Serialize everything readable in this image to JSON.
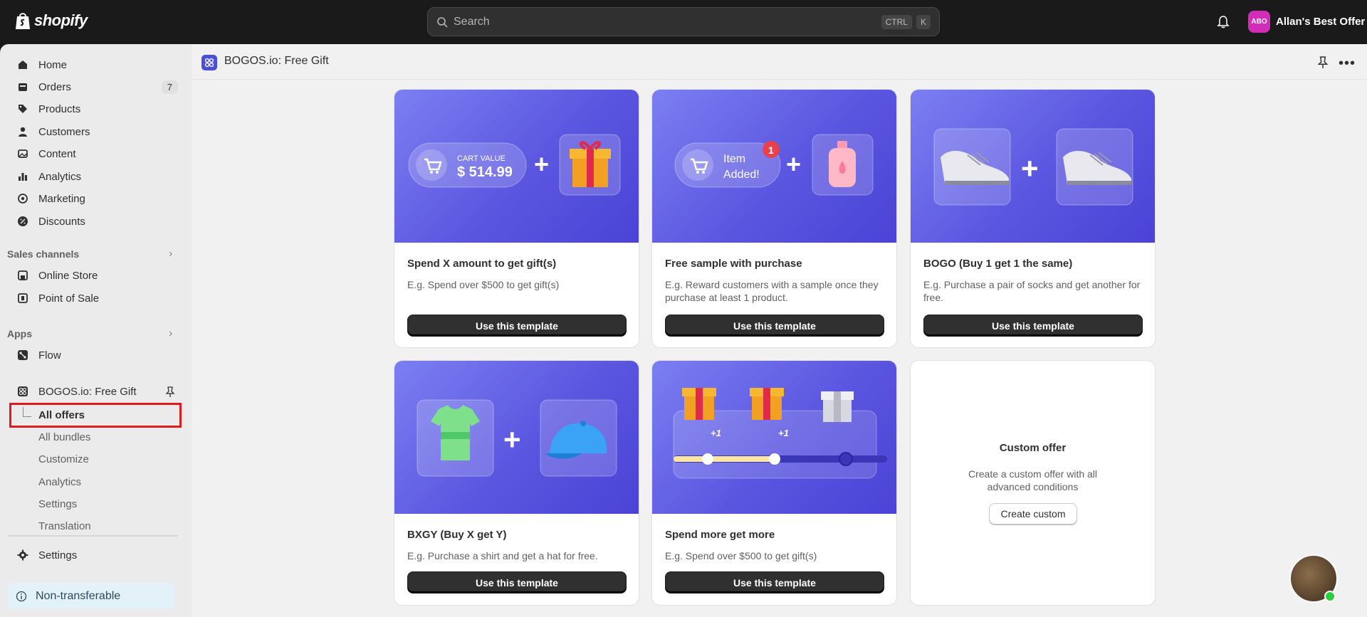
{
  "topbar": {
    "logo_text": "shopify",
    "search_placeholder": "Search",
    "shortcut_ctrl": "CTRL",
    "shortcut_k": "K",
    "store_initials": "ABO",
    "store_name": "Allan's Best Offer"
  },
  "sidebar": {
    "items": [
      {
        "label": "Home",
        "icon": "home-icon"
      },
      {
        "label": "Orders",
        "icon": "orders-icon",
        "badge": "7"
      },
      {
        "label": "Products",
        "icon": "tag-icon"
      },
      {
        "label": "Customers",
        "icon": "person-icon"
      },
      {
        "label": "Content",
        "icon": "content-icon"
      },
      {
        "label": "Analytics",
        "icon": "bar-chart-icon"
      },
      {
        "label": "Marketing",
        "icon": "target-icon"
      },
      {
        "label": "Discounts",
        "icon": "discount-icon"
      }
    ],
    "sales_channels_title": "Sales channels",
    "sales_channels": [
      {
        "label": "Online Store",
        "icon": "store-icon"
      },
      {
        "label": "Point of Sale",
        "icon": "pos-icon"
      }
    ],
    "apps_title": "Apps",
    "apps": [
      {
        "label": "Flow",
        "icon": "flow-icon"
      },
      {
        "label": "BOGOS.io: Free Gift",
        "icon": "bogos-app-icon"
      }
    ],
    "app_sub_items": [
      "All offers",
      "All bundles",
      "Customize",
      "Analytics",
      "Settings",
      "Translation"
    ],
    "settings_label": "Settings",
    "non_transferable": "Non-transferable"
  },
  "app_header": {
    "title": "BOGOS.io: Free Gift"
  },
  "cards": [
    {
      "title": "Spend X amount to get gift(s)",
      "desc": "E.g. Spend over $500 to get gift(s)",
      "button": "Use this template",
      "img_label_1": "CART VALUE",
      "img_label_2": "$ 514.99"
    },
    {
      "title": "Free sample with purchase",
      "desc": "E.g. Reward customers with a sample once they purchase at least 1 product.",
      "button": "Use this template",
      "img_label_1": "Item",
      "img_label_2": "Added!",
      "img_badge": "1"
    },
    {
      "title": "BOGO (Buy 1 get 1 the same)",
      "desc": "E.g. Purchase a pair of socks and get another for free.",
      "button": "Use this template"
    },
    {
      "title": "BXGY (Buy X get Y)",
      "desc": "E.g. Purchase a shirt and get a hat for free.",
      "button": "Use this template"
    },
    {
      "title": "Spend more get more",
      "desc": "E.g. Spend over $500 to get gift(s)",
      "button": "Use this template",
      "img_plus": "+1"
    }
  ],
  "custom_offer": {
    "title": "Custom offer",
    "desc": "Create a custom offer with all advanced conditions",
    "button": "Create custom"
  },
  "colors": {
    "topbar_bg": "#1a1a1a",
    "card_gradient": "#5b56e0",
    "highlight": "#e01b1b",
    "store_avatar": "#d12db8"
  }
}
